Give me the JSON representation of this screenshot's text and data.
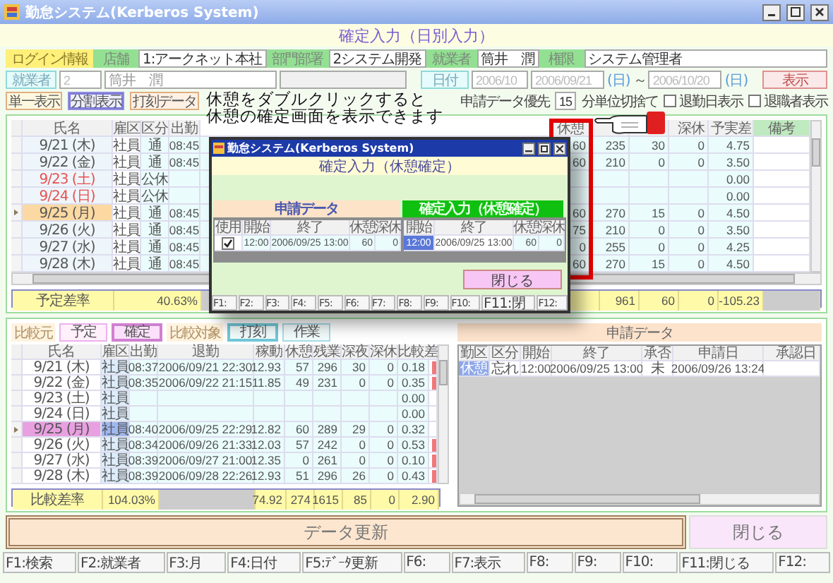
{
  "window": {
    "title": "勤怠システム(Kerberos System)"
  },
  "header": {
    "title": "確定入力（日別入力）"
  },
  "login": {
    "label": "ログイン情報",
    "fields": [
      {
        "label": "店舗",
        "value": "1:アークネット本社"
      },
      {
        "label": "部門部署",
        "value": "2システム開発"
      },
      {
        "label": "就業者",
        "value": "筒井　潤"
      },
      {
        "label": "権限",
        "value": "システム管理者"
      }
    ]
  },
  "employee": {
    "button": "就業者",
    "code": "2",
    "name": "筒井　潤"
  },
  "date": {
    "button": "日付",
    "month": "2006/10",
    "from": "2006/09/21",
    "from_day": "(日)",
    "separator": "～",
    "to": "2006/10/20",
    "to_day": "(日)",
    "show_button": "表示"
  },
  "view_buttons": [
    {
      "label": "単一表示",
      "selected": false
    },
    {
      "label": "分割表示",
      "selected": true
    },
    {
      "label": "打刻データ",
      "selected": false
    }
  ],
  "options": {
    "priority_label": "申請データ優先",
    "minutes": "15",
    "rounding_label": "分単位切捨て",
    "checkboxes": [
      {
        "label": "退勤日表示",
        "checked": false
      },
      {
        "label": "退職者表示",
        "checked": false
      }
    ]
  },
  "callout": {
    "lines": [
      "休憩をダブルクリックすると",
      "休憩の確定画面を表示できます"
    ]
  },
  "upper_table": {
    "columns_left": [
      "氏名",
      "雇区",
      "区分",
      "出勤"
    ],
    "columns_right": [
      "休憩",
      "深休",
      "予実差",
      "備考"
    ],
    "rows": [
      {
        "date": "9/21 (木)",
        "holiday": false,
        "selected": false,
        "employment": "社員",
        "type": "通",
        "in": "08:45",
        "break": "60",
        "column_7": "235",
        "column_8": "30",
        "deep_rest": "0",
        "plan_diff": "4.75"
      },
      {
        "date": "9/22 (金)",
        "holiday": false,
        "selected": false,
        "employment": "社員",
        "type": "通",
        "in": "08:45",
        "break": "60",
        "column_7": "210",
        "column_8": "0",
        "deep_rest": "0",
        "plan_diff": "3.50"
      },
      {
        "date": "9/23 (土)",
        "holiday": true,
        "selected": false,
        "employment": "社員",
        "type": "公休",
        "plan_diff": "0.00"
      },
      {
        "date": "9/24 (日)",
        "holiday": true,
        "selected": false,
        "employment": "社員",
        "type": "公休",
        "plan_diff": "0.00"
      },
      {
        "date": "9/25 (月)",
        "holiday": false,
        "selected": true,
        "employment": "社員",
        "type": "通",
        "in": "08:45",
        "break": "60",
        "column_7": "270",
        "column_8": "15",
        "deep_rest": "0",
        "plan_diff": "4.50"
      },
      {
        "date": "9/26 (火)",
        "holiday": false,
        "selected": false,
        "employment": "社員",
        "type": "通",
        "in": "08:45",
        "break": "75",
        "column_7": "210",
        "column_8": "0",
        "deep_rest": "0",
        "plan_diff": "3.50"
      },
      {
        "date": "9/27 (水)",
        "holiday": false,
        "selected": false,
        "employment": "社員",
        "type": "通",
        "in": "08:45",
        "break": "0",
        "column_7": "255",
        "column_8": "0",
        "deep_rest": "0",
        "plan_diff": "4.25"
      },
      {
        "date": "9/28 (木)",
        "holiday": false,
        "selected": false,
        "employment": "社員",
        "type": "通",
        "in": "08:45",
        "break": "60",
        "column_7": "270",
        "column_8": "15",
        "deep_rest": "0",
        "plan_diff": "4.50"
      }
    ],
    "summary": {
      "label": "予定差率",
      "rate": "40.63%",
      "values": [
        "961",
        "60",
        "0",
        "-105.23"
      ]
    }
  },
  "dialog": {
    "title": "勤怠システム(Kerberos System)",
    "heading": "確定入力（休憩確定）",
    "applied": {
      "label": "申請データ",
      "columns": [
        "使用",
        "開始",
        "終了",
        "休憩",
        "深休"
      ],
      "rows": [
        {
          "used": true,
          "start": "12:00",
          "end": "2006/09/25 13:00",
          "break": "60",
          "deep_rest": "0"
        }
      ]
    },
    "confirmed": {
      "label": "確定入力（休憩確定）",
      "columns": [
        "開始",
        "終了",
        "休憩",
        "深休"
      ],
      "rows": [
        {
          "selected": true,
          "start": "12:00",
          "end": "2006/09/25 13:00",
          "break": "60",
          "deep_rest": "0"
        }
      ]
    },
    "close_button": "閉じる",
    "function_keys": [
      "F1:",
      "F2:",
      "F3:",
      "F4:",
      "F5:",
      "F6:",
      "F7:",
      "F8:",
      "F9:",
      "F10:",
      "F11:閉",
      "F12:"
    ]
  },
  "compare_from": {
    "label": "比較元",
    "tabs": [
      {
        "label": "予定",
        "selected": false
      },
      {
        "label": "確定",
        "selected": true
      }
    ]
  },
  "compare_to": {
    "label": "比較対象",
    "tabs": [
      {
        "label": "打刻",
        "selected": true
      },
      {
        "label": "作業",
        "selected": false
      }
    ]
  },
  "lower_table": {
    "columns": [
      "氏名",
      "雇区",
      "出勤",
      "退勤",
      "稼動",
      "休憩",
      "残業",
      "深夜",
      "深休",
      "比較差"
    ],
    "rows": [
      {
        "date": "9/21 (木)",
        "selected": false,
        "employment": "社員",
        "in": "08:37",
        "out": "2006/09/21 22:30",
        "work": "12.93",
        "break": "57",
        "overtime": "296",
        "night": "30",
        "deep_rest": "0",
        "diff": "0.18",
        "flagged": true
      },
      {
        "date": "9/22 (金)",
        "selected": false,
        "employment": "社員",
        "in": "08:35",
        "out": "2006/09/22 21:15",
        "work": "11.85",
        "break": "49",
        "overtime": "231",
        "night": "0",
        "deep_rest": "0",
        "diff": "0.35",
        "flagged": true
      },
      {
        "date": "9/23 (土)",
        "selected": false,
        "employment": "社員",
        "diff": "0.00",
        "flagged": false
      },
      {
        "date": "9/24 (日)",
        "selected": false,
        "employment": "社員",
        "diff": "0.00",
        "flagged": false
      },
      {
        "date": "9/25 (月)",
        "selected": true,
        "employment": "社員",
        "in": "08:40",
        "out": "2006/09/25 22:29",
        "work": "12.82",
        "break": "60",
        "overtime": "289",
        "night": "29",
        "deep_rest": "0",
        "diff": "0.32",
        "flagged": false
      },
      {
        "date": "9/26 (火)",
        "selected": false,
        "employment": "社員",
        "in": "08:34",
        "out": "2006/09/26 21:33",
        "work": "12.03",
        "break": "57",
        "overtime": "242",
        "night": "0",
        "deep_rest": "0",
        "diff": "0.53",
        "flagged": true
      },
      {
        "date": "9/27 (水)",
        "selected": false,
        "employment": "社員",
        "in": "08:39",
        "out": "2006/09/27 21:00",
        "work": "12.35",
        "break": "0",
        "overtime": "261",
        "night": "0",
        "deep_rest": "0",
        "diff": "0.10",
        "flagged": true
      },
      {
        "date": "9/28 (木)",
        "selected": false,
        "employment": "社員",
        "in": "08:39",
        "out": "2006/09/28 22:26",
        "work": "12.93",
        "break": "51",
        "overtime": "296",
        "night": "26",
        "deep_rest": "0",
        "diff": "0.43",
        "flagged": true
      }
    ],
    "summary": {
      "label": "比較差率",
      "rate": "104.03%",
      "values": [
        "74.92",
        "274",
        "1615",
        "85",
        "0",
        "2.90"
      ]
    }
  },
  "request_panel": {
    "title": "申請データ",
    "columns": [
      "勤区",
      "区分",
      "開始",
      "終了",
      "承否",
      "申請日",
      "承認日"
    ],
    "rows": [
      {
        "selected": true,
        "attendance": "休憩",
        "type": "忘れ",
        "start": "12:00",
        "end": "2006/09/25 13:00",
        "approval": "未",
        "applied_on": "2006/09/26 13:24"
      }
    ]
  },
  "actions": [
    {
      "kind": "update",
      "label": "データ更新"
    },
    {
      "kind": "close",
      "label": "閉じる"
    }
  ],
  "function_keys": [
    "F1:検索",
    "F2:就業者",
    "F3:月",
    "F4:日付",
    "F5:ﾃﾞｰﾀ更新",
    "F6:",
    "F7:表示",
    "F8:",
    "F9:",
    "F10:",
    "F11:閉じる",
    "F12:"
  ]
}
